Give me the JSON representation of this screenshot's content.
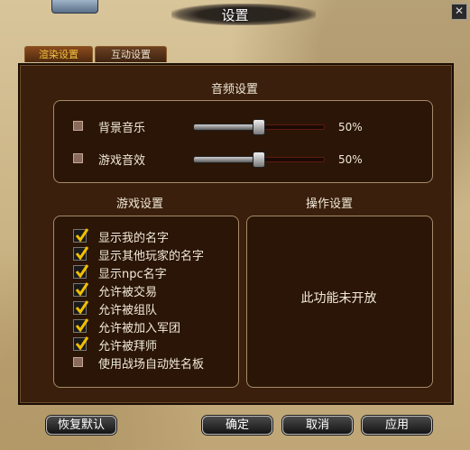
{
  "window": {
    "title": "设置",
    "close_glyph": "✕"
  },
  "tabs": [
    {
      "label": "渲染设置",
      "active": true
    },
    {
      "label": "互动设置",
      "active": false
    }
  ],
  "audio": {
    "title": "音频设置",
    "rows": [
      {
        "label": "背景音乐",
        "checked": false,
        "value_text": "50%",
        "value": 0.5
      },
      {
        "label": "游戏音效",
        "checked": false,
        "value_text": "50%",
        "value": 0.5
      }
    ]
  },
  "game_settings": {
    "title": "游戏设置",
    "options": [
      {
        "label": "显示我的名字",
        "checked": true
      },
      {
        "label": "显示其他玩家的名字",
        "checked": true
      },
      {
        "label": "显示npc名字",
        "checked": true
      },
      {
        "label": "允许被交易",
        "checked": true
      },
      {
        "label": "允许被组队",
        "checked": true
      },
      {
        "label": "允许被加入军团",
        "checked": true
      },
      {
        "label": "允许被拜师",
        "checked": true
      },
      {
        "label": "使用战场自动姓名板",
        "checked": false
      }
    ]
  },
  "operation_settings": {
    "title": "操作设置",
    "message": "此功能未开放"
  },
  "buttons": {
    "restore": "恢复默认",
    "confirm": "确定",
    "cancel": "取消",
    "apply": "应用"
  },
  "colors": {
    "panel": "#3a1f0c",
    "check": "#f0c000",
    "tab_active_text": "#f0c040"
  }
}
